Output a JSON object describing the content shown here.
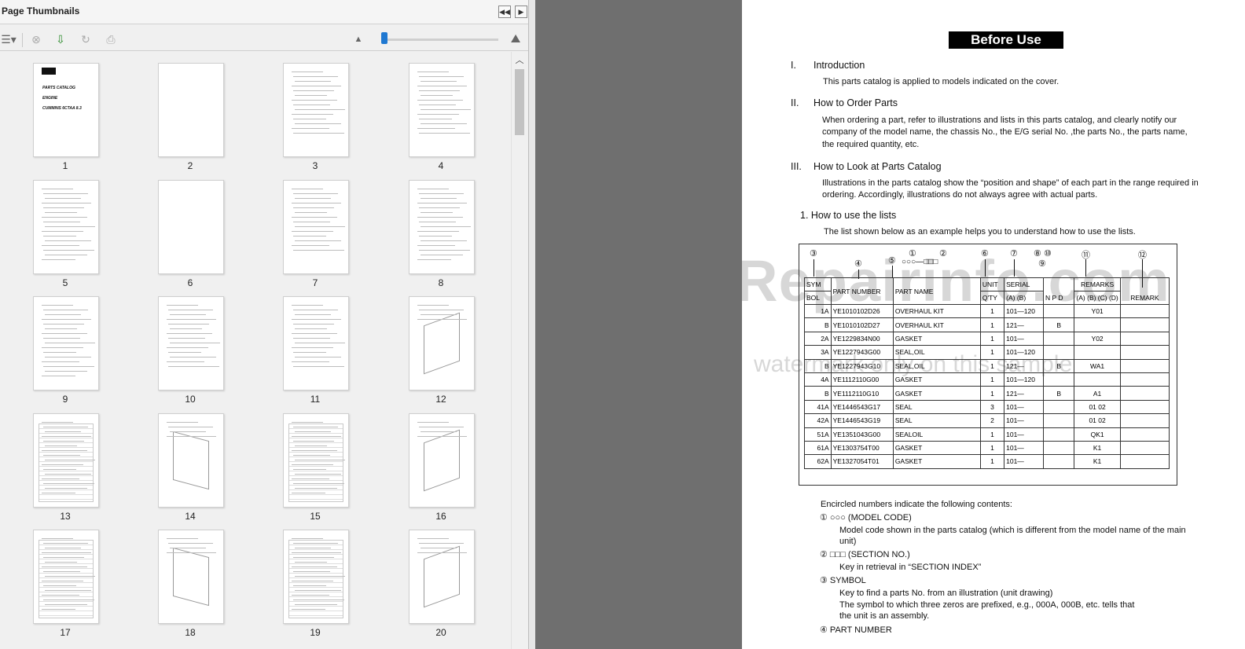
{
  "panel": {
    "title": "Page Thumbnails",
    "nav_prev": "◀◀",
    "nav_next": "▶",
    "zoom_fraction": 0.02,
    "thumbnails": [
      {
        "page": "1"
      },
      {
        "page": "2"
      },
      {
        "page": "3"
      },
      {
        "page": "4"
      },
      {
        "page": "5"
      },
      {
        "page": "6"
      },
      {
        "page": "7"
      },
      {
        "page": "8"
      },
      {
        "page": "9"
      },
      {
        "page": "10"
      },
      {
        "page": "11"
      },
      {
        "page": "12"
      },
      {
        "page": "13"
      },
      {
        "page": "14"
      },
      {
        "page": "15"
      },
      {
        "page": "16"
      },
      {
        "page": "17"
      },
      {
        "page": "18"
      },
      {
        "page": "19"
      },
      {
        "page": "20"
      }
    ],
    "cover_text": [
      "PARTS CATALOG",
      "ENGINE",
      "CUMMINS 6CTAA 8.3"
    ]
  },
  "document": {
    "title": "Before Use",
    "sections": {
      "s1_num": "I.",
      "s1_title": "Introduction",
      "s1_text": "This parts catalog is applied to models indicated on the cover.",
      "s2_num": "II.",
      "s2_title": "How to Order Parts",
      "s2_text1": "When ordering a part, refer to illustrations and lists in this parts catalog, and clearly notify our",
      "s2_text2": "company of the model name, the chassis No., the E/G serial No. ,the parts No., the parts name,",
      "s2_text3": "the required quantity, etc.",
      "s3_num": "III.",
      "s3_title": "How to Look at Parts Catalog",
      "s3_text1": "Illustrations in the parts catalog show the “position and shape” of each part in the range required in",
      "s3_text2": "ordering.    Accordingly, illustrations do not always agree with actual parts.",
      "s3_sub": "1.   How to use the lists",
      "s3_sub_text": "The list shown below as an example helps you to understand how to use the lists."
    },
    "example": {
      "circle_nums": [
        "③",
        "④",
        "⑤",
        "①",
        "②",
        "⑥",
        "⑦",
        "⑧",
        "⑨",
        "⑩",
        "⑪",
        "⑫"
      ],
      "code_label": "○○○—□□□",
      "headers": {
        "sym1": "SYM",
        "sym2": "BOL",
        "part_number": "PART NUMBER",
        "part_name": "PART NAME",
        "unit1": "UNIT",
        "unit2": "Q'TY",
        "serial1": "SERIAL",
        "serial2": "(A)  (B)",
        "npd": "N P D",
        "remarks1": "REMARKS",
        "remarks2": "(A)   (B)   (C)   (D)",
        "remark": "REMARK"
      },
      "rows": [
        {
          "sym": "1A",
          "pn": "YE1010102D26",
          "name": "OVERHAUL KIT",
          "qty": "1",
          "serial": "101—120",
          "npd": "",
          "remarks": "Y01"
        },
        {
          "sym": "B",
          "pn": "YE1010102D27",
          "name": "OVERHAUL KIT",
          "qty": "1",
          "serial": "121—",
          "npd": "B",
          "remarks": ""
        },
        {
          "sym": "2A",
          "pn": "YE1229834N00",
          "name": "GASKET",
          "qty": "1",
          "serial": "101—",
          "npd": "",
          "remarks": "Y02"
        },
        {
          "sym": "3A",
          "pn": "YE1227943G00",
          "name": "SEAL,OIL",
          "qty": "1",
          "serial": "101—120",
          "npd": "",
          "remarks": ""
        },
        {
          "sym": "B",
          "pn": "YE1227943G10",
          "name": "SEAL,OIL",
          "qty": "1",
          "serial": "121—",
          "npd": "B",
          "remarks": "WA1"
        },
        {
          "sym": "4A",
          "pn": "YE1112110G00",
          "name": "GASKET",
          "qty": "1",
          "serial": "101—120",
          "npd": "",
          "remarks": ""
        },
        {
          "sym": "B",
          "pn": "YE1112110G10",
          "name": "GASKET",
          "qty": "1",
          "serial": "121—",
          "npd": "B",
          "remarks": "A1"
        },
        {
          "sym": "41A",
          "pn": "YE1446543G17",
          "name": "SEAL",
          "qty": "3",
          "serial": "101—",
          "npd": "",
          "remarks": "01   02"
        },
        {
          "sym": "42A",
          "pn": "YE1446543G19",
          "name": "SEAL",
          "qty": "2",
          "serial": "101—",
          "npd": "",
          "remarks": "01   02"
        },
        {
          "sym": "51A",
          "pn": "YE1351043G00",
          "name": "SEALOIL",
          "qty": "1",
          "serial": "101—",
          "npd": "",
          "remarks": "QK1"
        },
        {
          "sym": "61A",
          "pn": "YE1303754T00",
          "name": "GASKET",
          "qty": "1",
          "serial": "101—",
          "npd": "",
          "remarks": "K1"
        },
        {
          "sym": "62A",
          "pn": "YE1327054T01",
          "name": "GASKET",
          "qty": "1",
          "serial": "101—",
          "npd": "",
          "remarks": "K1"
        }
      ]
    },
    "notes": {
      "intro": "Encircled numbers indicate the following contents:",
      "n1": "①  ○○○ (MODEL CODE)",
      "n1_a": "Model code shown in the parts catalog (which is different from the model name of the main",
      "n1_b": "unit)",
      "n2": "②  □□□ (SECTION NO.)",
      "n2_a": "Key in retrieval in “SECTION INDEX”",
      "n3": "③  SYMBOL",
      "n3_a": "Key to find a parts No. from an illustration (unit drawing)",
      "n3_b": "The symbol to which three zeros are prefixed, e.g., 000A, 000B, etc. tells that",
      "n3_c": "the unit is an assembly.",
      "n4": "④  PART NUMBER"
    },
    "watermark_1": "eRepairinfo.com",
    "watermark_2": "watermark only on this sample"
  }
}
